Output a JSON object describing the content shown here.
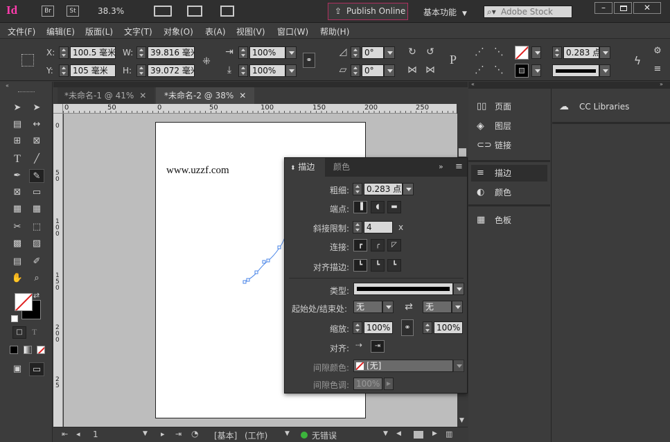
{
  "appbar": {
    "logo": "Id",
    "br": "Br",
    "st": "St",
    "zoom": "38.3%",
    "publish": "Publish Online",
    "workspace": "基本功能",
    "search_placeholder": "Adobe Stock"
  },
  "menu": [
    "文件(F)",
    "编辑(E)",
    "版面(L)",
    "文字(T)",
    "对象(O)",
    "表(A)",
    "视图(V)",
    "窗口(W)",
    "帮助(H)"
  ],
  "control": {
    "x_label": "X:",
    "x": "100.5 毫米",
    "y_label": "Y:",
    "y": "105 毫米",
    "w_label": "W:",
    "w": "39.816 毫米",
    "h_label": "H:",
    "h": "39.072 毫米",
    "scale_x": "100%",
    "scale_y": "100%",
    "rotate": "0°",
    "shear": "0°",
    "stroke": "0.283 点"
  },
  "tabs": [
    {
      "label": "*未命名-1 @ 41%"
    },
    {
      "label": "*未命名-2 @ 38%"
    }
  ],
  "ruler_top": [
    "0",
    "50",
    "100",
    "50",
    "0",
    "50",
    "100",
    "150",
    "200",
    "250"
  ],
  "ruler_left": [
    "0",
    "5",
    "0",
    "1",
    "0",
    "0",
    "1",
    "5",
    "0",
    "2",
    "0",
    "0",
    "2",
    "5"
  ],
  "page_text": "www.uzzf.com",
  "stroke_panel": {
    "tab_stroke": "描边",
    "tab_color": "颜色",
    "weight_label": "粗细:",
    "weight": "0.283 点",
    "cap_label": "端点:",
    "miter_label": "斜接限制:",
    "miter": "4",
    "miter_unit": "x",
    "join_label": "连接:",
    "align_label": "对齐描边:",
    "type_label": "类型:",
    "startend_label": "起始处/结束处:",
    "start": "无",
    "end": "无",
    "scale_label": "缩放:",
    "scale1": "100%",
    "scale2": "100%",
    "align2_label": "对齐:",
    "gap_color_label": "间隙颜色:",
    "gap_color": "[无]",
    "gap_tint_label": "间隙色调:",
    "gap_tint": "100%"
  },
  "right_panels": {
    "pages": "页面",
    "layers": "图层",
    "links": "链接",
    "stroke": "描边",
    "color": "颜色",
    "swatches": "色板",
    "cc": "CC Libraries"
  },
  "status": {
    "page": "1",
    "style": "[基本]",
    "mode": "(工作)",
    "errors": "无错误"
  }
}
